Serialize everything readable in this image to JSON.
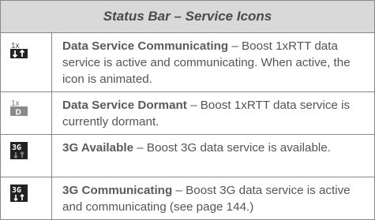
{
  "table": {
    "title": "Status Bar – Service Icons",
    "rows": [
      {
        "icon": "1x-arrows-icon",
        "title": "Data Service Communicating",
        "text": " – Boost 1xRTT data service is active and communicating. When active, the icon is animated."
      },
      {
        "icon": "1x-dormant-icon",
        "title": "Data Service Dormant",
        "text": " – Boost 1xRTT data service is currently dormant."
      },
      {
        "icon": "3g-available-icon",
        "title": "3G Available",
        "text": " – Boost 3G data service is available."
      },
      {
        "icon": "3g-communicating-icon",
        "title": "3G Communicating",
        "text": " – Boost 3G data service is active and communicating (see page 144.)"
      }
    ]
  }
}
